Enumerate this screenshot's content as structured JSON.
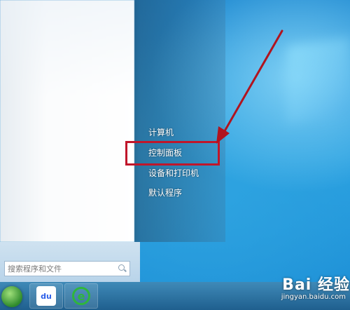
{
  "start_menu": {
    "right_items": [
      {
        "label": "计算机"
      },
      {
        "label": "控制面板"
      },
      {
        "label": "设备和打印机"
      },
      {
        "label": "默认程序"
      }
    ],
    "search": {
      "placeholder": "搜索程序和文件"
    }
  },
  "taskbar": {
    "baidu_label": "du"
  },
  "watermark": {
    "logo": "Bai 经验",
    "site": "jingyan.baidu.com"
  },
  "annotation": {
    "highlight_color": "#c0162a",
    "arrow_color": "#b0141f"
  }
}
